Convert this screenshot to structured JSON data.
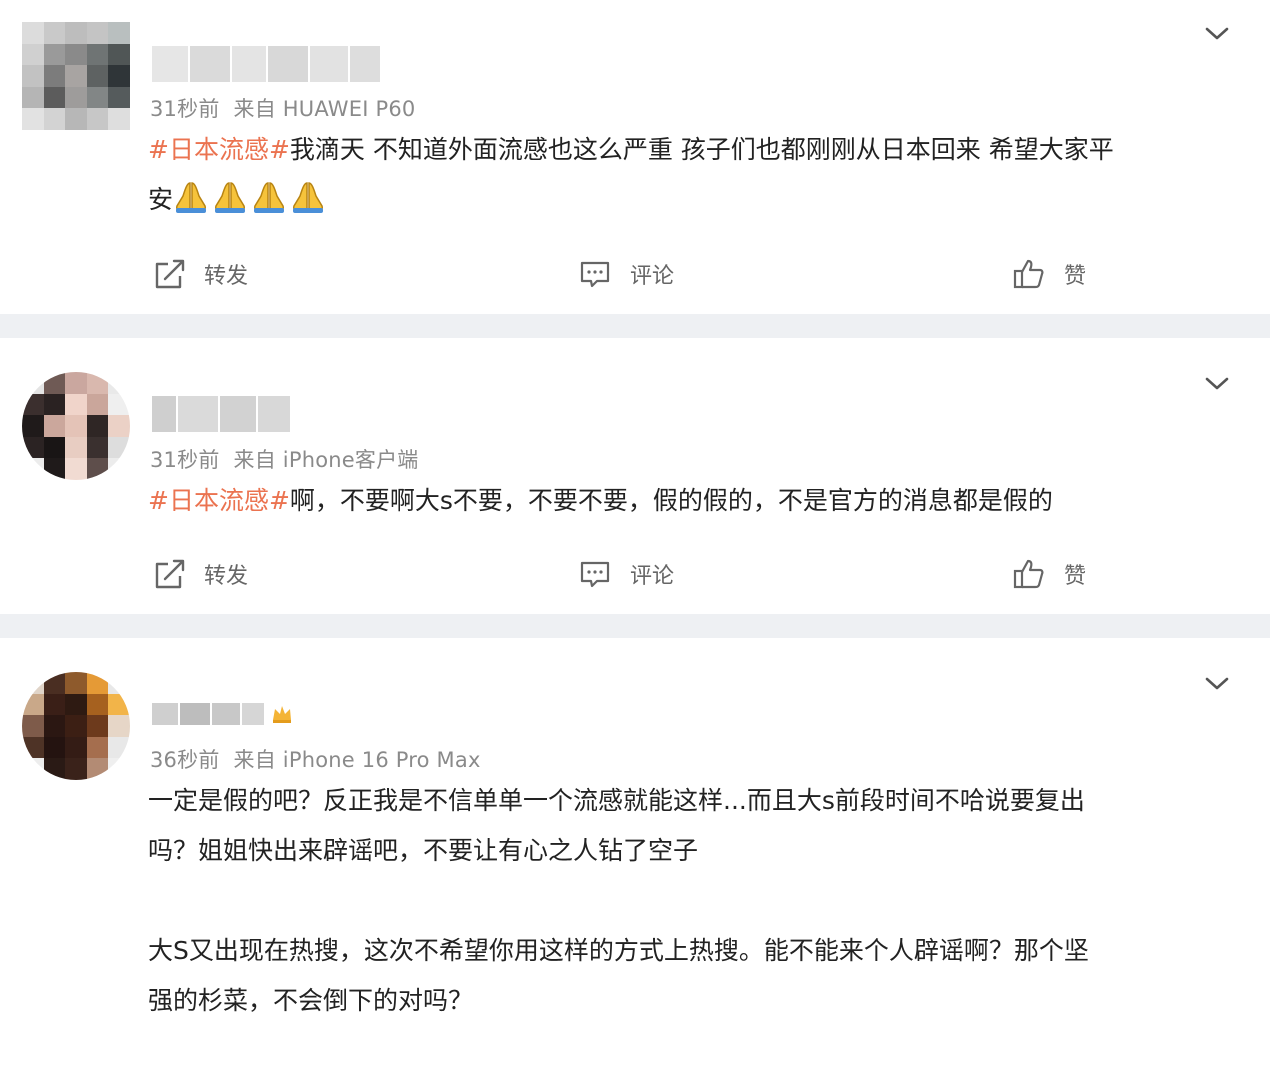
{
  "posts": [
    {
      "meta": {
        "time": "31秒前",
        "source": "来自 HUAWEI P60"
      },
      "hashtag": "#日本流感#",
      "lines": [
        "我滴天 不知道外面流感也这么严重 孩子们也都刚刚从日本回来 希望大家平",
        "安"
      ],
      "emoji": [
        "folded-hands-emoji",
        "folded-hands-emoji",
        "folded-hands-emoji",
        "folded-hands-emoji"
      ],
      "actions": {
        "repost": "转发",
        "comment": "评论",
        "like": "赞"
      }
    },
    {
      "meta": {
        "time": "31秒前",
        "source": "来自 iPhone客户端"
      },
      "hashtag": "#日本流感#",
      "text": "啊，不要啊大s不要，不要不要，假的假的，不是官方的消息都是假的",
      "actions": {
        "repost": "转发",
        "comment": "评论",
        "like": "赞"
      }
    },
    {
      "meta": {
        "time": "36秒前",
        "source": "来自 iPhone 16 Pro Max"
      },
      "paragraphs": [
        {
          "lines": [
            "一定是假的吧？反正我是不信单单一个流感就能这样...而且大s前段时间不哈说要复出",
            "吗？姐姐快出来辟谣吧，不要让有心之人钻了空子"
          ]
        },
        {
          "lines": [
            "大S又出现在热搜，这次不希望你用这样的方式上热搜。能不能来个人辟谣啊？那个坚",
            "强的杉菜，不会倒下的对吗？"
          ]
        }
      ]
    }
  ],
  "colors": {
    "hashtag": "#eb7350",
    "meta": "#8a8a8a",
    "text": "#222222",
    "action": "#666666",
    "divider": "#eef0f3"
  }
}
